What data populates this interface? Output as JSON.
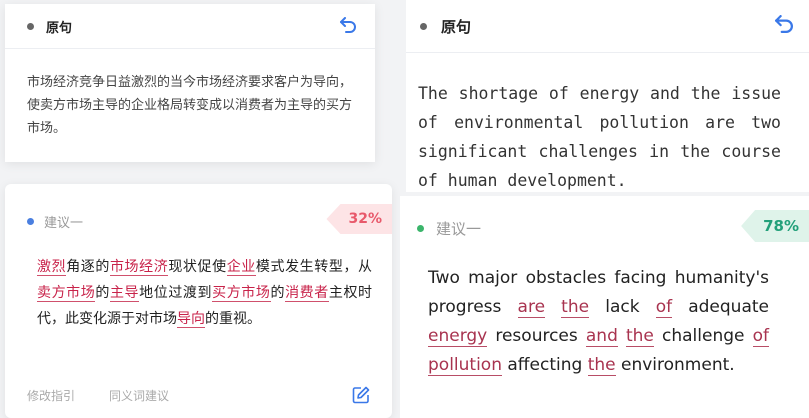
{
  "left": {
    "original": {
      "title": "原句",
      "text": "市场经济竞争日益激烈的当今市场经济要求客户为导向，使卖方市场主导的企业格局转变成以消费者为主导的买方市场。"
    },
    "suggestion": {
      "label": "建议一",
      "percent": "32%",
      "segments": [
        {
          "t": "激烈",
          "hl": true
        },
        {
          "t": "角逐的",
          "hl": false
        },
        {
          "t": "市场经济",
          "hl": true
        },
        {
          "t": "现状促使",
          "hl": false
        },
        {
          "t": "企业",
          "hl": true
        },
        {
          "t": "模式发生转型，从",
          "hl": false
        },
        {
          "t": "卖方市场",
          "hl": true
        },
        {
          "t": "的",
          "hl": false
        },
        {
          "t": "主导",
          "hl": true
        },
        {
          "t": "地位过渡到",
          "hl": false
        },
        {
          "t": "买方市场",
          "hl": true
        },
        {
          "t": "的",
          "hl": false
        },
        {
          "t": "消费者",
          "hl": true
        },
        {
          "t": "主权时代，此变化源于对市场",
          "hl": false
        },
        {
          "t": "导向",
          "hl": true
        },
        {
          "t": "的重视。",
          "hl": false
        }
      ],
      "footer": {
        "guide": "修改指引",
        "synonyms": "同义词建议"
      }
    }
  },
  "right": {
    "original": {
      "title": "原句",
      "text": "The shortage of energy and the issue of environmental pollution are two significant challenges in the course of human development."
    },
    "suggestion": {
      "label": "建议一",
      "percent": "78%",
      "segments": [
        {
          "t": "Two major obstacles facing humanity's progress ",
          "hl": false
        },
        {
          "t": "are",
          "hl": true
        },
        {
          "t": " ",
          "hl": false
        },
        {
          "t": "the",
          "hl": true
        },
        {
          "t": " lack ",
          "hl": false
        },
        {
          "t": "of",
          "hl": true
        },
        {
          "t": " adequate ",
          "hl": false
        },
        {
          "t": "energy",
          "hl": true
        },
        {
          "t": " resources ",
          "hl": false
        },
        {
          "t": "and",
          "hl": true
        },
        {
          "t": " ",
          "hl": false
        },
        {
          "t": "the",
          "hl": true
        },
        {
          "t": " challenge ",
          "hl": false
        },
        {
          "t": "of",
          "hl": true
        },
        {
          "t": " ",
          "hl": false
        },
        {
          "t": "pollution",
          "hl": true
        },
        {
          "t": " affecting ",
          "hl": false
        },
        {
          "t": "the",
          "hl": true
        },
        {
          "t": " environment.",
          "hl": false
        }
      ]
    }
  },
  "icons": {
    "undo": "undo-icon",
    "edit": "edit-icon"
  },
  "colors": {
    "accent": "#3a78e8",
    "highlight": "#c8234a",
    "pct_low": "#e8596b",
    "pct_high": "#23a07a"
  }
}
